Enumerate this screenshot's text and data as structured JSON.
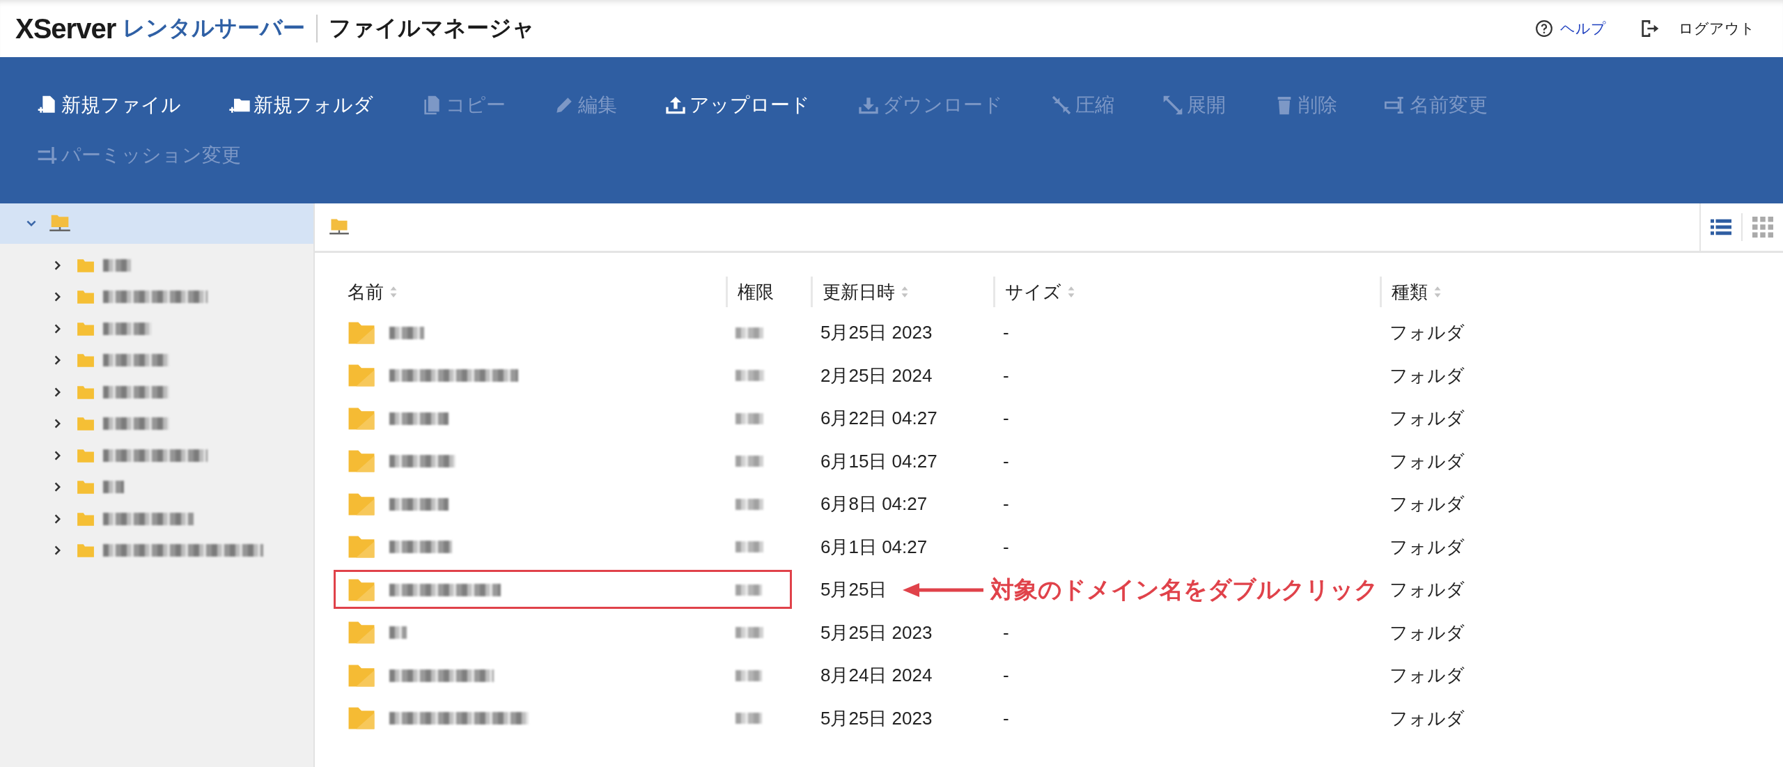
{
  "header": {
    "logo_main": "XServer",
    "logo_sub": "レンタルサーバー",
    "app_title": "ファイルマネージャ",
    "links": [
      {
        "kind": "help",
        "label": "ヘルプ"
      },
      {
        "kind": "logout",
        "label": "ログアウト"
      }
    ]
  },
  "toolbar": [
    {
      "kind": "new-file",
      "label": "新規ファイル",
      "disabled": false
    },
    {
      "kind": "new-folder",
      "label": "新規フォルダ",
      "disabled": false
    },
    {
      "kind": "copy",
      "label": "コピー",
      "disabled": true
    },
    {
      "kind": "edit",
      "label": "編集",
      "disabled": true
    },
    {
      "kind": "upload",
      "label": "アップロード",
      "disabled": false
    },
    {
      "kind": "download",
      "label": "ダウンロード",
      "disabled": true
    },
    {
      "kind": "compress",
      "label": "圧縮",
      "disabled": true
    },
    {
      "kind": "extract",
      "label": "展開",
      "disabled": true
    },
    {
      "kind": "delete",
      "label": "削除",
      "disabled": true
    },
    {
      "kind": "rename",
      "label": "名前変更",
      "disabled": true
    },
    {
      "kind": "permission",
      "label": "パーミッション変更",
      "disabled": true
    }
  ],
  "tree": {
    "expanded": true,
    "selected": true,
    "children": [
      {
        "expanded": false,
        "selected": false
      },
      {
        "expanded": false,
        "selected": false
      },
      {
        "expanded": false,
        "selected": false
      },
      {
        "expanded": false,
        "selected": false
      },
      {
        "expanded": false,
        "selected": false
      },
      {
        "expanded": false,
        "selected": false
      },
      {
        "expanded": false,
        "selected": false
      },
      {
        "expanded": false,
        "selected": false
      },
      {
        "expanded": false,
        "selected": false
      },
      {
        "expanded": false,
        "selected": false
      }
    ]
  },
  "view_toggle": [
    {
      "kind": "list",
      "selected": true
    },
    {
      "kind": "grid",
      "selected": false
    }
  ],
  "table": {
    "columns": [
      {
        "label": "名前",
        "sortable": true
      },
      {
        "label": "権限",
        "sortable": false
      },
      {
        "label": "更新日時",
        "sortable": true
      },
      {
        "label": "サイズ",
        "sortable": true
      },
      {
        "label": "種類",
        "sortable": true
      }
    ],
    "rows": [
      {
        "modified": "5月25日 2023",
        "size": "-",
        "type": "フォルダ",
        "highlighted": false
      },
      {
        "modified": "2月25日 2024",
        "size": "-",
        "type": "フォルダ",
        "highlighted": false
      },
      {
        "modified": "6月22日 04:27",
        "size": "-",
        "type": "フォルダ",
        "highlighted": false
      },
      {
        "modified": "6月15日 04:27",
        "size": "-",
        "type": "フォルダ",
        "highlighted": false
      },
      {
        "modified": "6月8日 04:27",
        "size": "-",
        "type": "フォルダ",
        "highlighted": false
      },
      {
        "modified": "6月1日 04:27",
        "size": "-",
        "type": "フォルダ",
        "highlighted": false
      },
      {
        "modified": "5月25日",
        "type": "フォルダ",
        "highlighted": true,
        "annotation": "対象のドメイン名をダブルクリック"
      },
      {
        "modified": "5月25日 2023",
        "size": "-",
        "type": "フォルダ",
        "highlighted": false
      },
      {
        "modified": "8月24日 2024",
        "size": "-",
        "type": "フォルダ",
        "highlighted": false
      },
      {
        "modified": "5月25日 2023",
        "size": "-",
        "type": "フォルダ",
        "highlighted": false
      }
    ]
  }
}
